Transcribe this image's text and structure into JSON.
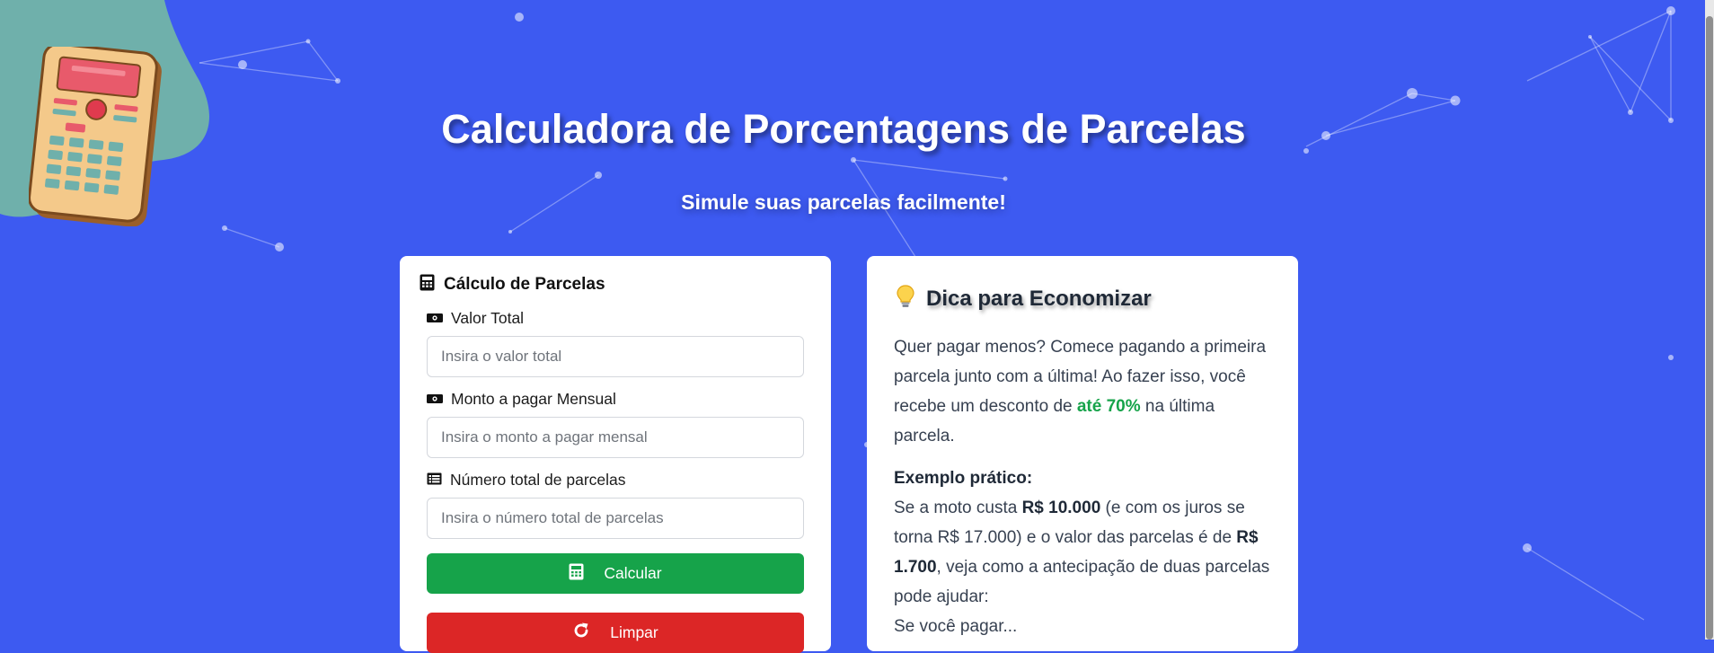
{
  "header": {
    "title": "Calculadora de Porcentagens de Parcelas",
    "subtitle": "Simule suas parcelas facilmente!"
  },
  "calculator": {
    "heading": "Cálculo de Parcelas",
    "fields": [
      {
        "label": "Valor Total",
        "placeholder": "Insira o valor total",
        "value": ""
      },
      {
        "label": "Monto a pagar Mensual",
        "placeholder": "Insira o monto a pagar mensal",
        "value": ""
      },
      {
        "label": "Número total de parcelas",
        "placeholder": "Insira o número total de parcelas",
        "value": ""
      }
    ],
    "calculate_label": "Calcular",
    "clear_label": "Limpar"
  },
  "tip": {
    "title": "Dica para Economizar",
    "p1_before": "Quer pagar menos? Comece pagando a primeira parcela junto com a última! Ao fazer isso, você recebe um desconto de ",
    "p1_highlight": "até 70%",
    "p1_after": " na última parcela.",
    "example_heading": "Exemplo prático:",
    "ex_t1": "Se a moto custa ",
    "ex_b1": "R$ 10.000",
    "ex_t2": " (e com os juros se torna R$ 17.000) e o valor das parcelas é de ",
    "ex_b2": "R$ 1.700",
    "ex_t3": ", veja como a antecipação de duas parcelas pode ajudar:",
    "cut_text": "Se você pagar..."
  },
  "colors": {
    "background": "#3d5af1",
    "calculate_button": "#16a34a",
    "clear_button": "#dc2626",
    "highlight": "#16a34a"
  },
  "icons": {
    "card_heading": "calculator-icon",
    "field_1": "money-bill-icon",
    "field_2": "money-bill-icon",
    "field_3": "list-icon",
    "calculate_button": "calculator-icon",
    "clear_button": "redo-icon",
    "tip": "lightbulb-icon"
  }
}
